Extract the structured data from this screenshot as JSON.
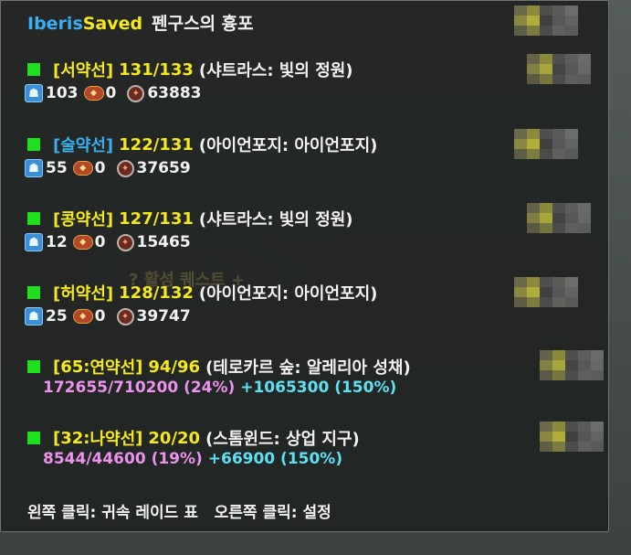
{
  "header": {
    "name_part1": "Iberis",
    "name_part2": "Saved",
    "subtitle": "펜구스의 흉포"
  },
  "background_text": "? 활성 퀘스트 +",
  "entries": [
    {
      "name": "[서약선]",
      "progress": "131/133",
      "location": "(샤트라스: 빛의 정원)",
      "monster": "103",
      "coin": "0",
      "badge": "63883"
    },
    {
      "name": "[술약선]",
      "progress": "122/131",
      "location": "(아이언포지: 아이언포지)",
      "monster": "55",
      "coin": "0",
      "badge": "37659"
    },
    {
      "name": "[콩약선]",
      "progress": "127/131",
      "location": "(샤트라스: 빛의 정원)",
      "monster": "12",
      "coin": "0",
      "badge": "15465"
    },
    {
      "name": "[허약선]",
      "progress": "128/132",
      "location": "(아이언포지: 아이언포지)",
      "monster": "25",
      "coin": "0",
      "badge": "39747"
    }
  ],
  "entries_xp": [
    {
      "name_prefix": "[65:",
      "name_main": "연약선",
      "name_suffix": "]",
      "progress": "94/96",
      "location": "(테로카르 숲: 알레리아 성채)",
      "xp": "172655/710200 (24%)",
      "rested": "+1065300 (150%)"
    },
    {
      "name_prefix": "[32:",
      "name_main": "나약선",
      "name_suffix": "]",
      "progress": "20/20",
      "location": "(스톰윈드: 상업 지구)",
      "xp": "8544/44600 (19%)",
      "rested": "+66900 (150%)"
    }
  ],
  "footer": {
    "left_click": "왼쪽 클릭: 귀속 레이드 표",
    "right_click": "오른쪽 클릭: 설정"
  },
  "icons": {
    "monster": "monster-head-icon",
    "coin": "coin-icon",
    "badge": "badge-medal-icon"
  },
  "colors": {
    "blue": "#3aaef0",
    "yellow": "#f5e81e",
    "green": "#1fe01f",
    "pink": "#ec91ec",
    "cyan": "#5fe0f2"
  }
}
